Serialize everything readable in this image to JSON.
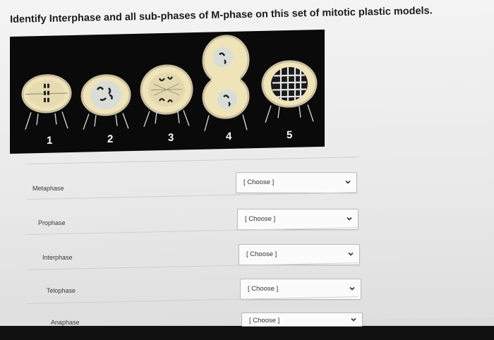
{
  "question": "Identify Interphase and all sub-phases of M-phase on this set of mitotic plastic models.",
  "figure": {
    "labels": [
      "1",
      "2",
      "3",
      "4",
      "5"
    ]
  },
  "matches": [
    {
      "term": "Metaphase",
      "selected": "[ Choose ]"
    },
    {
      "term": "Prophase",
      "selected": "[ Choose ]"
    },
    {
      "term": "Interphase",
      "selected": "[ Choose ]"
    },
    {
      "term": "Telophase",
      "selected": "[ Choose ]"
    },
    {
      "term": "Anaphase",
      "selected": "[ Choose ]"
    }
  ],
  "colors": {
    "model_cream": "#efe3b8",
    "model_rim": "#cfc6a8",
    "nucleus": "#d6d6cc",
    "figure_bg": "#0a0a0a"
  },
  "icons": [
    "chevron-down-icon"
  ]
}
